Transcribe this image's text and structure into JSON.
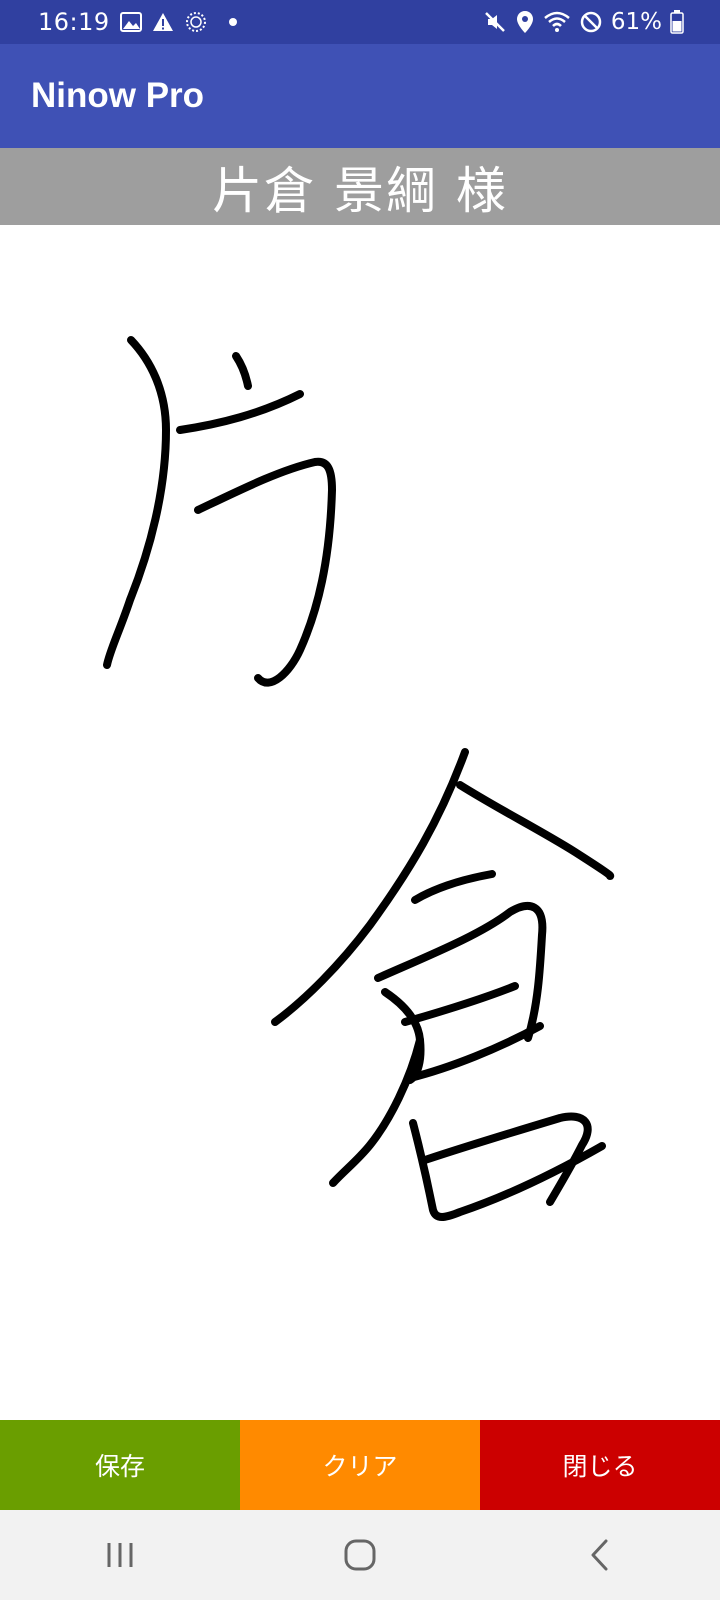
{
  "status_bar": {
    "time": "16:19",
    "battery": "61%",
    "left_icons": [
      "image-icon",
      "warning-icon",
      "sync-icon",
      "dot-icon"
    ],
    "right_icons": [
      "mute-icon",
      "location-icon",
      "wifi-icon",
      "no-data-icon",
      "battery-icon"
    ],
    "background": "#3040a0"
  },
  "app_bar": {
    "title": "Ninow Pro",
    "background": "#3f51b5"
  },
  "name_header": {
    "text": "片倉 景綱 様",
    "background": "#9e9e9e"
  },
  "actions": {
    "save_label": "保存",
    "clear_label": "クリア",
    "close_label": "閉じる",
    "save_color": "#6a9e00",
    "clear_color": "#ff8a00",
    "close_color": "#cc0000"
  },
  "nav_bar": {
    "icons": [
      "recent-apps-icon",
      "home-icon",
      "back-icon"
    ]
  }
}
